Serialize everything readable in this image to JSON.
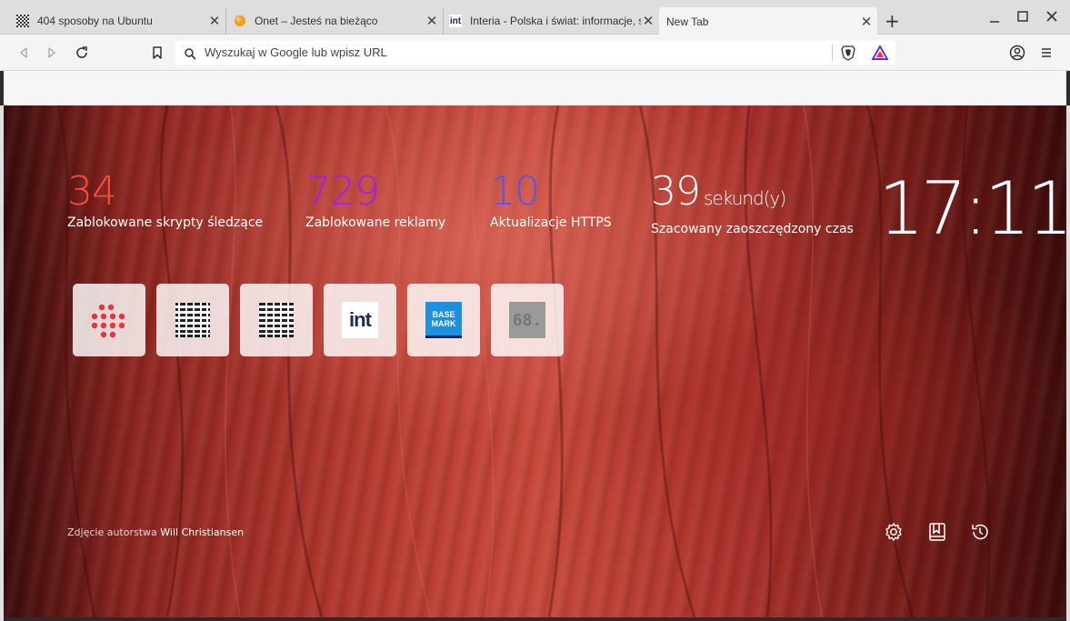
{
  "tabs": [
    {
      "title": "404 sposoby na Ubuntu",
      "favicon": "checker-favicon"
    },
    {
      "title": "Onet – Jesteś na bieżąco",
      "favicon": "onet-orange-favicon"
    },
    {
      "title": "Interia - Polska i świat: informacje, sport",
      "favicon": "int-favicon"
    },
    {
      "title": "New Tab",
      "favicon": "none"
    }
  ],
  "new_tab_symbol": "+",
  "window_controls": {
    "minimize": "–",
    "maximize": "□",
    "close": "✕"
  },
  "toolbar": {
    "search_placeholder": "Wyszukaj w Google lub wpisz URL",
    "icons": [
      "back-icon",
      "forward-icon",
      "reload-icon",
      "bookmark-icon",
      "search-icon",
      "brave-shields-icon",
      "brave-rewards-icon",
      "profile-icon",
      "menu-icon"
    ]
  },
  "stats": {
    "trackers": {
      "value": "34",
      "label": "Zablokowane skrypty śledzące",
      "color": "#ff4a3a"
    },
    "ads": {
      "value": "729",
      "label": "Zablokowane reklamy",
      "color": "#a020f0"
    },
    "https": {
      "value": "10",
      "label": "Aktualizacje HTTPS",
      "color": "#5856e8"
    },
    "time": {
      "value": "39",
      "unit": "sekund(y)",
      "label": "Szacowany zaoszczędzony czas",
      "color": "#ffffff"
    }
  },
  "clock": "17:11",
  "tiles": [
    {
      "name": "onet-dots"
    },
    {
      "name": "ubuntu-404-pattern-1"
    },
    {
      "name": "ubuntu-404-pattern-2"
    },
    {
      "name": "interia",
      "text": "int"
    },
    {
      "name": "basemark",
      "text": "BASE MARK"
    },
    {
      "name": "site-68",
      "text": "68."
    }
  ],
  "credit": {
    "prefix": "Zdjęcie autorstwa",
    "author": "Will Christiansen"
  },
  "bottom_icons": [
    "settings-icon",
    "bookmarks-icon",
    "history-icon"
  ]
}
